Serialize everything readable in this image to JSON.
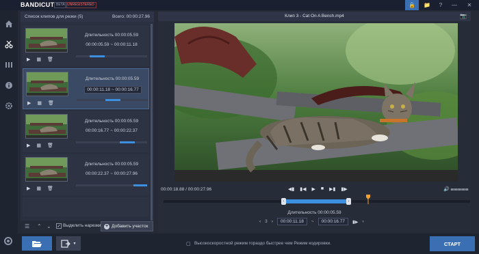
{
  "app": {
    "logo_bandi": "BANDI",
    "logo_cut": "CUT",
    "beta": "BETA",
    "unregistered": "UNREGISTERED"
  },
  "titlebar_icons": [
    "lock-icon",
    "folder-icon",
    "help-icon",
    "minimize-icon",
    "close-icon"
  ],
  "nav_icons": [
    "home-icon",
    "cut-icon",
    "split-icon",
    "info-icon",
    "settings-icon"
  ],
  "clip_list": {
    "title": "Список клипов для резки (5)",
    "total": "Всего: 00:00:27.96",
    "clips": [
      {
        "duration": "Длительность 00:00:05.59",
        "range": "00:00:05.59 ~ 00:00:11.18",
        "progress": 0.4
      },
      {
        "duration": "Длительность 00:00:05.59",
        "range": "00:00:11.18 ~ 00:00:16.77",
        "progress": 0.6
      },
      {
        "duration": "Длительность 00:00:05.59",
        "range": "00:00:16.77 ~ 00:00:22.37",
        "progress": 0.8
      },
      {
        "duration": "Длительность 00:00:05.59",
        "range": "00:00:22.37 ~ 00:00:27.96",
        "progress": 1.0
      }
    ],
    "select_label": "Выделить нарезки",
    "add_label": "Добавить участок"
  },
  "player": {
    "title": "Клип 3 - Cat On A Bench.mp4",
    "position": "00:00:18.88 / 00:00:27.96",
    "duration": "Длительность 00:00:05.59",
    "segment_number": "3",
    "start": "00:00:11.18",
    "end": "00:00:16.77"
  },
  "bottom": {
    "tip": "Высокоскоростной режим гораздо быстрее чем Режим кодировки.",
    "start_label": "СТАРТ"
  }
}
